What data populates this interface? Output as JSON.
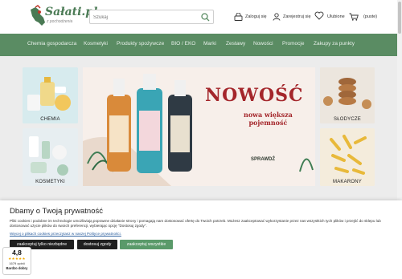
{
  "header": {
    "logo_text": "Sałati.pl",
    "logo_sub": "z pochodzenia",
    "search_placeholder": "Szukaj",
    "login_label": "Zaloguj się",
    "register_label": "Zarejestruj się",
    "favorites_label": "Ulubione",
    "cart_label": "(puste)"
  },
  "nav": {
    "items": [
      "Chemia gospodarcza",
      "Kosmetyki",
      "Produkty spożywcze",
      "BIO / EKO",
      "Marki",
      "Zestawy",
      "Nowości",
      "Promocje",
      "Zakupy za punkty"
    ]
  },
  "tiles": {
    "chemia": "CHEMIA",
    "kosmetyki": "KOSMETYKI",
    "slodycze": "SŁODYCZE",
    "makarony": "MAKARONY"
  },
  "banner": {
    "title": "NOWOŚĆ",
    "sub_line1": "nowa większa",
    "sub_line2": "pojemność",
    "cta": "SPRAWDŹ"
  },
  "cookie": {
    "title": "Dbamy o Twoją prywatność",
    "text": "Pliki cookies i podobne im technologie umożliwiają poprawne działanie strony i pomagają nam dostosować ofertę do Twoich potrzeb. Możesz zaakceptować wykorzystanie przez nas wszystkich tych plików i przejść do sklepu lub dostosować użycie plików do swoich preferencji, wybierając opcję \"Dostosuj zgody\".",
    "link": "Więcej o plikach cookies przeczytasz w naszej Polityce prywatności.",
    "btn_necessary": "zaakceptuj tylko niezbędne",
    "btn_customize": "dostosuj zgody",
    "btn_accept_all": "zaakceptuj wszystkie"
  },
  "rating": {
    "score": "4,8",
    "stars": "★★★★★",
    "count": "1679 opinii",
    "label": "Bardzo dobry"
  },
  "colors": {
    "nav_bg": "#5a8c63",
    "accent_red": "#a4262b",
    "button_green": "#5a9a6a",
    "button_dark": "#1f1f1f"
  }
}
